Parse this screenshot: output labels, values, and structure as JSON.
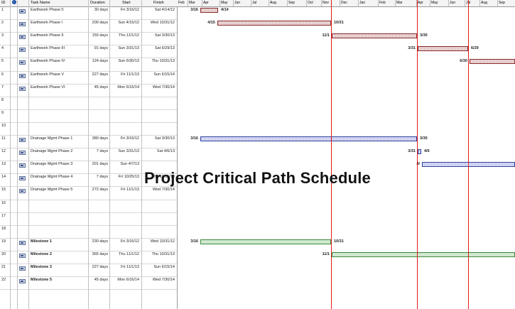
{
  "title": "Project Critical Path Schedule",
  "columns": {
    "id": "ID",
    "name": "Task Name",
    "duration": "Duration",
    "start": "Start",
    "finish": "Finish"
  },
  "months": [
    "Feb",
    "Mar",
    "Apr",
    "May",
    "Jun",
    "Jul",
    "Aug",
    "Sep",
    "Oct",
    "Nov",
    "Dec",
    "Jan",
    "Feb",
    "Mar",
    "Apr",
    "May",
    "Jun",
    "Jul",
    "Aug",
    "Sep"
  ],
  "rows": [
    {
      "id": "1",
      "name": "Earthwork Phase 0",
      "duration": "30 days",
      "start": "Fri 3/16/12",
      "finish": "Sat 4/14/12"
    },
    {
      "id": "2",
      "name": "Earthwork Phase I",
      "duration": "200 days",
      "start": "Sun 4/15/12",
      "finish": "Wed 10/31/12"
    },
    {
      "id": "3",
      "name": "Earthwork Phase II",
      "duration": "150 days",
      "start": "Thu 11/1/12",
      "finish": "Sat 3/30/13"
    },
    {
      "id": "4",
      "name": "Earthwork Phase III",
      "duration": "91 days",
      "start": "Sun 3/31/13",
      "finish": "Sat 6/29/13"
    },
    {
      "id": "5",
      "name": "Earthwork Phase IV",
      "duration": "124 days",
      "start": "Sun 6/30/13",
      "finish": "Thu 10/31/13"
    },
    {
      "id": "6",
      "name": "Earthwork Phase V",
      "duration": "227 days",
      "start": "Fri 11/1/13",
      "finish": "Sun 6/15/14"
    },
    {
      "id": "7",
      "name": "Earthwork Phase VI",
      "duration": "45 days",
      "start": "Mon 6/16/14",
      "finish": "Wed 7/30/14"
    },
    {
      "id": "8",
      "name": "",
      "duration": "",
      "start": "",
      "finish": ""
    },
    {
      "id": "9",
      "name": "",
      "duration": "",
      "start": "",
      "finish": ""
    },
    {
      "id": "10",
      "name": "",
      "duration": "",
      "start": "",
      "finish": ""
    },
    {
      "id": "11",
      "name": "Drainage Mgmt Phase 1",
      "duration": "380 days",
      "start": "Fri 3/16/12",
      "finish": "Sat 3/30/13"
    },
    {
      "id": "12",
      "name": "Drainage Mgmt Phase 2",
      "duration": "7 days",
      "start": "Sun 3/31/13",
      "finish": "Sat 4/6/13"
    },
    {
      "id": "13",
      "name": "Drainage Mgmt Phase 3",
      "duration": "201 days",
      "start": "Sun 4/7/13",
      "finish": ""
    },
    {
      "id": "14",
      "name": "Drainage Mgmt Phase 4",
      "duration": "7 days",
      "start": "Fri 10/25/13",
      "finish": "Thu 10/31/13"
    },
    {
      "id": "15",
      "name": "Drainage Mgmt Phase 5",
      "duration": "272 days",
      "start": "Fri 11/1/13",
      "finish": "Wed 7/30/14"
    },
    {
      "id": "16",
      "name": "",
      "duration": "",
      "start": "",
      "finish": ""
    },
    {
      "id": "17",
      "name": "",
      "duration": "",
      "start": "",
      "finish": ""
    },
    {
      "id": "18",
      "name": "",
      "duration": "",
      "start": "",
      "finish": ""
    },
    {
      "id": "19",
      "name": "Milestone 1",
      "duration": "230 days",
      "start": "Fri 3/16/12",
      "finish": "Wed 10/31/12"
    },
    {
      "id": "20",
      "name": "Milestone 2",
      "duration": "365 days",
      "start": "Thu 11/1/12",
      "finish": "Thu 10/31/13"
    },
    {
      "id": "21",
      "name": "Milestone 3",
      "duration": "227 days",
      "start": "Fri 11/1/13",
      "finish": "Sun 6/15/14"
    },
    {
      "id": "22",
      "name": "Milestone 5",
      "duration": "45 days",
      "start": "Mon 6/16/14",
      "finish": "Wed 7/30/14"
    }
  ],
  "bars": [
    {
      "row": 1,
      "color": "brown",
      "start_label": "3/16",
      "end_label": "4/14"
    },
    {
      "row": 2,
      "color": "brown",
      "start_label": "4/15",
      "end_label": "10/31"
    },
    {
      "row": 3,
      "color": "brown",
      "start_label": "11/1",
      "end_label": "3/30"
    },
    {
      "row": 4,
      "color": "brown",
      "start_label": "3/31",
      "end_label": "6/29"
    },
    {
      "row": 5,
      "color": "brown",
      "start_label": "6/30",
      "end_label": ""
    },
    {
      "row": 11,
      "color": "blue",
      "start_label": "3/16",
      "end_label": "3/30"
    },
    {
      "row": 12,
      "color": "blue",
      "start_label": "3/31",
      "end_label": "4/6"
    },
    {
      "row": 13,
      "color": "blue",
      "start_label": "4/",
      "end_label": ""
    },
    {
      "row": 19,
      "color": "green",
      "start_label": "3/16",
      "end_label": "10/31"
    },
    {
      "row": 20,
      "color": "green",
      "start_label": "11/1",
      "end_label": ""
    }
  ],
  "colors": {
    "critical_line": "#e01a1a",
    "earthwork": "#8b2a2a",
    "drainage": "#34449e",
    "milestone": "#3c8a3c"
  }
}
